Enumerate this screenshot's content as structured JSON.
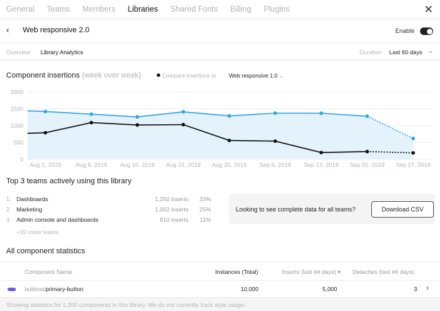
{
  "top_tabs": [
    "General",
    "Teams",
    "Members",
    "Libraries",
    "Shared Fonts",
    "Billing",
    "Plugins"
  ],
  "active_tab": "Libraries",
  "header": {
    "title": "Web responsive 2.0",
    "enable_label": "Enable",
    "enabled": true
  },
  "subnav": {
    "overview": "Overview",
    "analytics": "Library Analytics",
    "duration_label": "Duration",
    "duration_value": "Last 60 days"
  },
  "insertions": {
    "title": "Component insertions",
    "subtitle": "(week over week)",
    "compare_label": "Compare insertions to",
    "compare_value": "Web responsive 1.0"
  },
  "chart_data": {
    "type": "line",
    "categories": [
      "Aug 2, 2019",
      "Aug 9, 2019",
      "Aug 16, 2019",
      "Aug 23, 2019",
      "Aug 30, 2019",
      "Sep 6, 2019",
      "Sep 13, 2019",
      "Sep 20, 2019",
      "Sep 27, 2019"
    ],
    "y_ticks": [
      "2000",
      "1500",
      "1000",
      "500",
      "0"
    ],
    "ylim": [
      0,
      2000
    ],
    "series": [
      {
        "name": "Web responsive 2.0",
        "color": "#2ea3e6",
        "values": [
          1420,
          1340,
          1260,
          1410,
          1290,
          1370,
          1370,
          1280,
          620
        ],
        "dashed_last": true,
        "area": true
      },
      {
        "name": "Web responsive 1.0",
        "color": "#111111",
        "values": [
          790,
          1090,
          1020,
          1030,
          560,
          540,
          200,
          230,
          190
        ],
        "dashed_last": true,
        "area": false
      }
    ],
    "grid": true,
    "extra_start": {
      "blue": 1440,
      "black": 770
    }
  },
  "teams": {
    "title": "Top 3 teams actively using this library",
    "rows": [
      {
        "num": "1.",
        "name": "Dashboards",
        "inserts": "1,250 inserts",
        "pct": "33%"
      },
      {
        "num": "2.",
        "name": "Marketing",
        "inserts": "1,002 inserts",
        "pct": "25%"
      },
      {
        "num": "3.",
        "name": "Admin console and dashboards",
        "inserts": "810 inserts",
        "pct": "11%"
      }
    ],
    "more": "+20 more teams"
  },
  "cta": {
    "text": "Looking to see complete data for all teams?",
    "button": "Download CSV"
  },
  "stats": {
    "title": "All component statistics",
    "columns": [
      "Component Name",
      "Instances (Total)",
      "Inserts (last ## days)",
      "Detaches (last ## days)"
    ],
    "sort_arrow": "▾",
    "rows": [
      {
        "name_prefix": "buttons/",
        "name": "primary-button",
        "instances": "10,000",
        "inserts": "5,000",
        "detaches": "3",
        "color": "#6b5be8"
      }
    ]
  },
  "footer": "Showing statistics for 1,200 components in this library. We do not currently track style usage."
}
